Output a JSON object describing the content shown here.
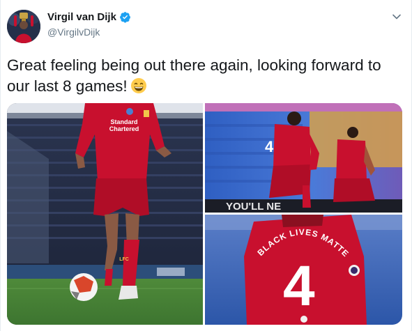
{
  "author": {
    "name": "Virgil van Dijk",
    "handle": "@VirgilvDijk",
    "verified": true
  },
  "tweet": {
    "text": "Great feeling being out there again, looking forward to our last 8 games!",
    "emoji": "grinning-face-with-smiling-eyes"
  },
  "media": {
    "photo1": {
      "sponsor": "Standard Chartered",
      "sleeve_text": "LFC"
    },
    "photo2": {
      "shirt_number": "4",
      "banner_text": "YOU'LL NE"
    },
    "photo3": {
      "shirt_number": "4",
      "collar_text": "BLACK LIVES MATTER"
    }
  },
  "colors": {
    "accent": "#1da1f2",
    "liverpool_red": "#c8102e",
    "muted": "#657786"
  }
}
